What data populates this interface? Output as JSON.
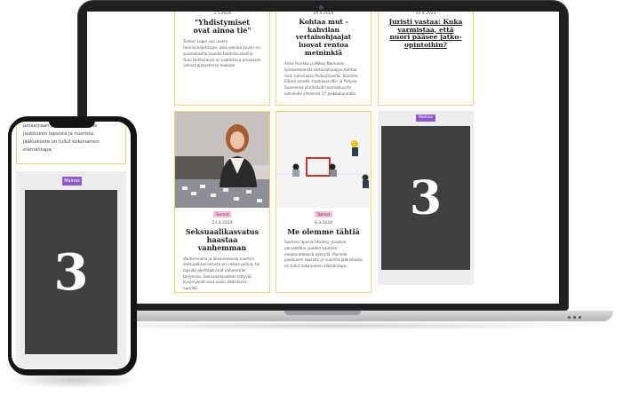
{
  "laptop": {
    "cards_top": [
      {
        "date": "3.5.2024",
        "title": "\"Yhdistymiset ovat ainoa tie\"",
        "body": "Tunturi Lappi saa uuden toiminnanjohtajan, joka vahvaa kuvan eri suomalaisilla tasoilla toimista alueilla. Oulu Hiihtoseura on osallistuva prosessiin vahvat ajatustensa mukaan."
      },
      {
        "date": "24.4.2024",
        "title": "Kohtaa mut -kahvilan vertaisohjaajat luovat rentoa meininkiä",
        "body": "Anne Honkka ja Mikko Nieminen työskentelevät vertaisohjaajina Kohtaa mut -kahvilassa Pudasjärvellä. Toiminta Elämä omalle -hankkeen Nä- ja Pohjois-Suomessa yhdistävät marraskuusta kahvilalle yhteensä 17 paikkakunnalla."
      },
      {
        "date": "10.4.2023",
        "title": "Juristi vastaa: Kuka varmistaa, että nuori pääsee jatko-opintoihin?"
      }
    ],
    "cards_bottom": [
      {
        "tag": "Teemat",
        "date": "23.4.2024",
        "title": "Seksuaalikasvatus haastaa vanhemman",
        "body": "Vanhemmilla ja lähisuhteessa nuorten seksuaalikasvatusta on vaikea puhua, tai lapsilla opettajat ovat vähemmän tarjonnan. Seksuaalisuuteen liittyvät kysymykset ovat usein ahdistavia nuorille."
      },
      {
        "tag": "Teemat",
        "date": "6.3.2024",
        "title": "Me olemme tähtiä",
        "body": "Suomen Special Hockey -joukkue perustettiin vuoden kauteen mielenrohkeasti syksyllä. Monelle joukkueen lapsista ja nuorista jääkiekosta on tullut kokonainen elämäntapa."
      }
    ],
    "ad": {
      "label": "Mainos",
      "number": "3"
    }
  },
  "phone": {
    "text": "pelaamaan jääkiekkoa. Monelle joukkueen lapsista ja nuorista jääkiekosta on tullut kokonainen elämäntapa.",
    "ad": {
      "label": "Mainos",
      "number": "3"
    }
  }
}
